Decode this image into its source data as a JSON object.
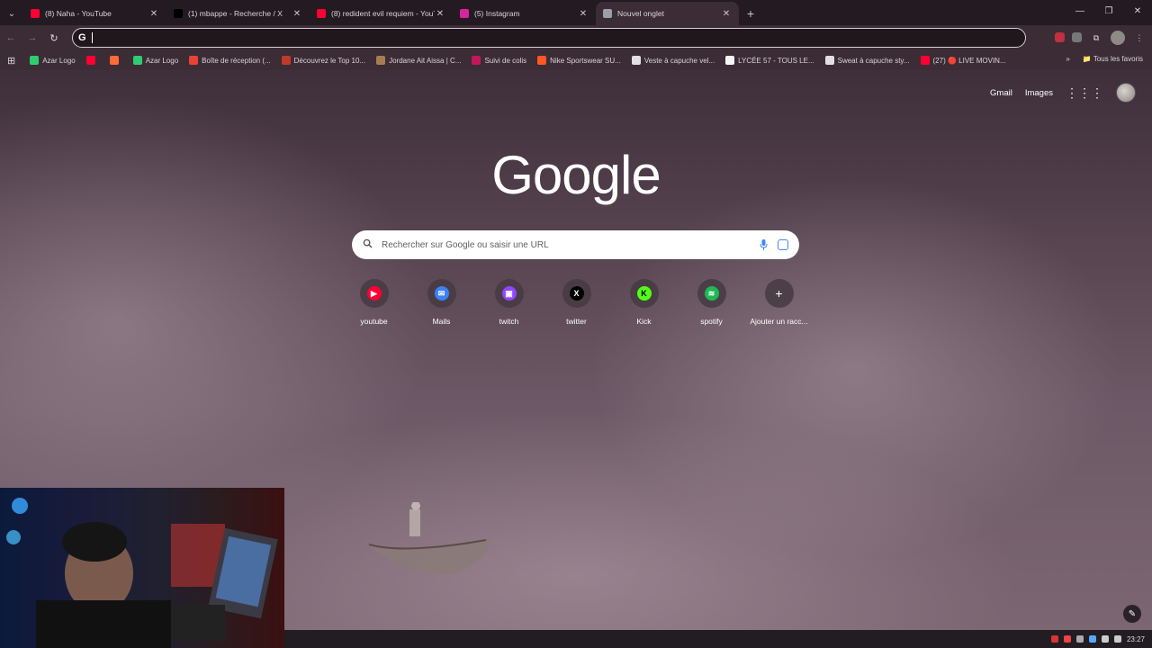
{
  "tabs": [
    {
      "title": "(8) Naha - YouTube",
      "favicon": "youtube-icon",
      "color": "#ff0033",
      "active": false
    },
    {
      "title": "(1) mbappe - Recherche / X",
      "favicon": "x-icon",
      "color": "#000000",
      "active": false
    },
    {
      "title": "(8) redident evil requiem - YouT",
      "favicon": "youtube-icon",
      "color": "#ff0033",
      "active": false
    },
    {
      "title": "(5) Instagram",
      "favicon": "instagram-icon",
      "color": "#d6249f",
      "active": false
    },
    {
      "title": "Nouvel onglet",
      "favicon": "chrome-icon",
      "color": "#9aa0a6",
      "active": true
    }
  ],
  "bookmarks": [
    {
      "label": "Azar Logo",
      "color": "#2ecc71"
    },
    {
      "label": "",
      "color": "#ff0033"
    },
    {
      "label": "",
      "color": "#ff6b35"
    },
    {
      "label": "Azar Logo",
      "color": "#2ecc71"
    },
    {
      "label": "Boîte de réception (...",
      "color": "#ea4335"
    },
    {
      "label": "Découvrez le Top 10...",
      "color": "#c0392b"
    },
    {
      "label": "Jordane Ait Aissa | C...",
      "color": "#a67c52"
    },
    {
      "label": "Suivi de colis",
      "color": "#c2185b"
    },
    {
      "label": "Nike Sportswear SU...",
      "color": "#ff5722"
    },
    {
      "label": "Veste à capuche vel...",
      "color": "#e0e0e0"
    },
    {
      "label": "LYCÉE 57 - TOUS LE...",
      "color": "#f5f5f5"
    },
    {
      "label": "Sweat à capuche sty...",
      "color": "#e0e0e0"
    },
    {
      "label": "(27) 🔴 LIVE MOVIN...",
      "color": "#ff0033"
    }
  ],
  "bookmarks_all": "Tous les favoris",
  "header": {
    "gmail": "Gmail",
    "images": "Images"
  },
  "logo": "Google",
  "search": {
    "placeholder": "Rechercher sur Google ou saisir une URL"
  },
  "shortcuts": [
    {
      "label": "youtube",
      "icon": "youtube-icon",
      "color": "#ff0033",
      "glyph": "▶"
    },
    {
      "label": "Mails",
      "icon": "mail-icon",
      "color": "#3b82f6",
      "glyph": "✉"
    },
    {
      "label": "twitch",
      "icon": "twitch-icon",
      "color": "#9146ff",
      "glyph": "▣"
    },
    {
      "label": "twitter",
      "icon": "x-icon",
      "color": "#000000",
      "glyph": "X"
    },
    {
      "label": "Kick",
      "icon": "kick-icon",
      "color": "#53fc18",
      "glyph": "K"
    },
    {
      "label": "spotify",
      "icon": "spotify-icon",
      "color": "#1db954",
      "glyph": "≋"
    },
    {
      "label": "Ajouter un racc...",
      "icon": "plus-icon",
      "color": "transparent",
      "glyph": "+"
    }
  ],
  "clock": "23:27"
}
